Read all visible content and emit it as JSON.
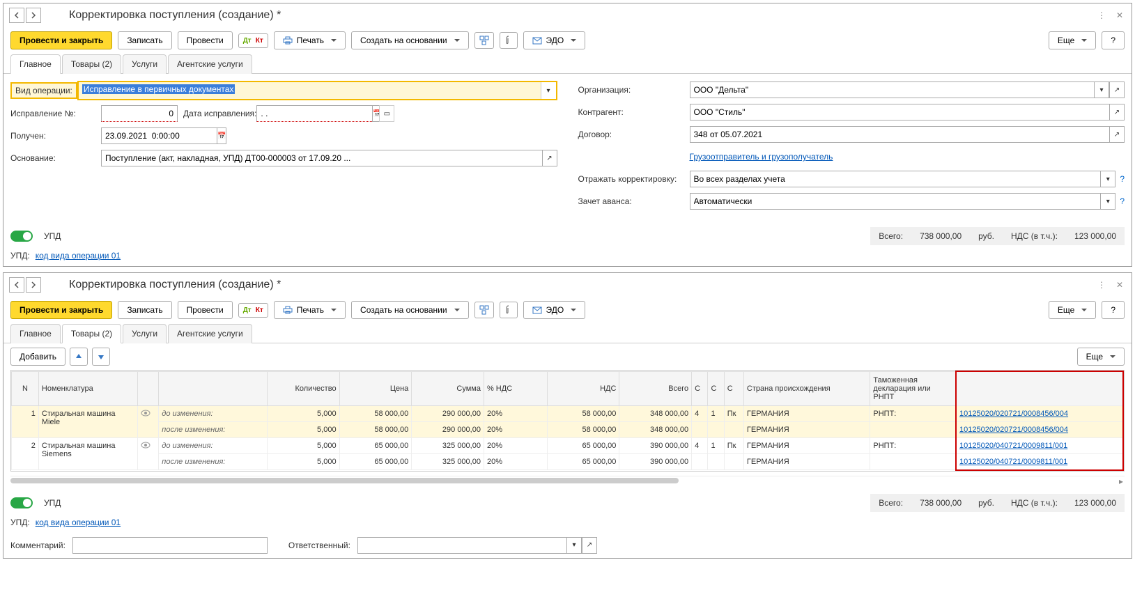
{
  "title": "Корректировка поступления (создание) *",
  "toolbar": {
    "post_close": "Провести и закрыть",
    "save": "Записать",
    "post": "Провести",
    "print": "Печать",
    "create_based": "Создать на основании",
    "edo": "ЭДО",
    "more": "Еще",
    "help": "?"
  },
  "tabs": {
    "main": "Главное",
    "goods": "Товары (2)",
    "services": "Услуги",
    "agent": "Агентские услуги"
  },
  "form": {
    "op_type_label": "Вид операции:",
    "op_type_value": "Исправление в первичных документах",
    "fix_no_label": "Исправление №:",
    "fix_no_value": "0",
    "fix_date_label": "Дата исправления:",
    "fix_date_value": ". .",
    "received_label": "Получен:",
    "received_value": "23.09.2021  0:00:00",
    "basis_label": "Основание:",
    "basis_value": "Поступление (акт, накладная, УПД) ДТ00-000003 от 17.09.20 ...",
    "org_label": "Организация:",
    "org_value": "ООО \"Дельта\"",
    "counterparty_label": "Контрагент:",
    "counterparty_value": "ООО \"Стиль\"",
    "contract_label": "Договор:",
    "contract_value": "348 от 05.07.2021",
    "consignor_link": "Грузоотправитель и грузополучатель",
    "reflect_label": "Отражать корректировку:",
    "reflect_value": "Во всех разделах учета",
    "advance_label": "Зачет аванса:",
    "advance_value": "Автоматически"
  },
  "upd": {
    "label": "УПД",
    "upd_prefix": "УПД:",
    "op_code_link": "код вида операции 01"
  },
  "totals": {
    "total_label": "Всего:",
    "total_value": "738 000,00",
    "currency": "руб.",
    "vat_label": "НДС (в т.ч.):",
    "vat_value": "123 000,00"
  },
  "grid_toolbar": {
    "add": "Добавить",
    "more": "Еще"
  },
  "columns": {
    "n": "N",
    "nomen": "Номенклатура",
    "qty": "Количество",
    "price": "Цена",
    "sum": "Сумма",
    "vat_pct": "% НДС",
    "vat": "НДС",
    "total": "Всего",
    "c1": "С",
    "c2": "С",
    "c3": "С",
    "country": "Страна происхождения",
    "customs": "Таможенная декларация или РНПТ"
  },
  "change_labels": {
    "before": "до изменения:",
    "after": "после изменения:"
  },
  "rows": [
    {
      "n": "1",
      "name": "Стиральная машина Miele",
      "before": {
        "qty": "5,000",
        "price": "58 000,00",
        "sum": "290 000,00",
        "vat_pct": "20%",
        "vat": "58 000,00",
        "total": "348 000,00",
        "c1": "4",
        "c2": "1",
        "c3": "Пк",
        "country": "ГЕРМАНИЯ",
        "rnpt_label": "РНПТ:",
        "rnpt": "10125020/020721/0008456/004"
      },
      "after": {
        "qty": "5,000",
        "price": "58 000,00",
        "sum": "290 000,00",
        "vat_pct": "20%",
        "vat": "58 000,00",
        "total": "348 000,00",
        "c1": "",
        "c2": "",
        "c3": "",
        "country": "ГЕРМАНИЯ",
        "rnpt_label": "",
        "rnpt": "10125020/020721/0008456/004"
      }
    },
    {
      "n": "2",
      "name": "Стиральная машина Siemens",
      "before": {
        "qty": "5,000",
        "price": "65 000,00",
        "sum": "325 000,00",
        "vat_pct": "20%",
        "vat": "65 000,00",
        "total": "390 000,00",
        "c1": "4",
        "c2": "1",
        "c3": "Пк",
        "country": "ГЕРМАНИЯ",
        "rnpt_label": "РНПТ:",
        "rnpt": "10125020/040721/0009811/001"
      },
      "after": {
        "qty": "5,000",
        "price": "65 000,00",
        "sum": "325 000,00",
        "vat_pct": "20%",
        "vat": "65 000,00",
        "total": "390 000,00",
        "c1": "",
        "c2": "",
        "c3": "",
        "country": "ГЕРМАНИЯ",
        "rnpt_label": "",
        "rnpt": "10125020/040721/0009811/001"
      }
    }
  ],
  "bottom": {
    "comment_label": "Комментарий:",
    "responsible_label": "Ответственный:"
  }
}
